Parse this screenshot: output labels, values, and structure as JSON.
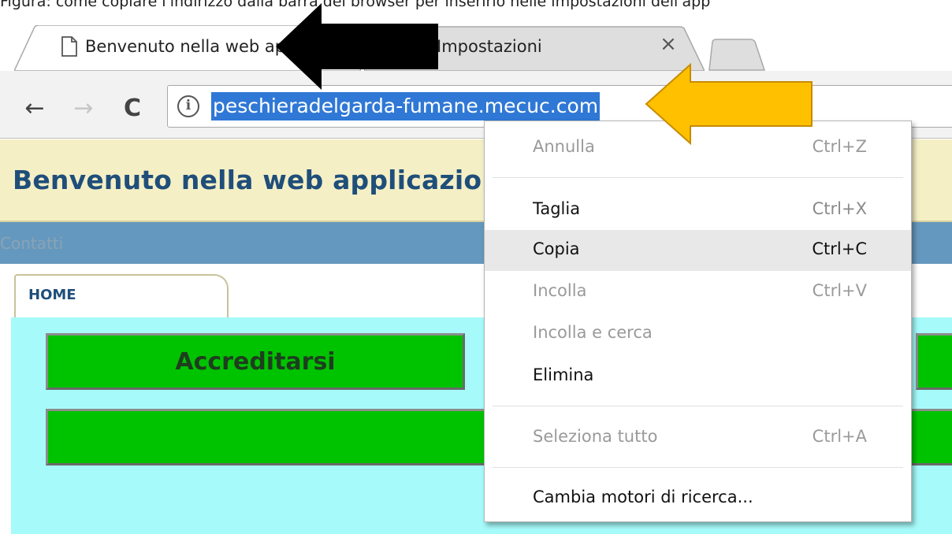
{
  "caption": "Figura: come copiare l'indirizzo dalla barra del browser per inserirlo nelle impostazioni dell'app",
  "tabs": [
    {
      "title": "Benvenuto nella web applicazione",
      "active": true
    },
    {
      "title": "Impostazioni",
      "active": false
    }
  ],
  "toolbar": {
    "url": "peschieradelgarda-fumane.mecuc.com",
    "icons": {
      "back": "arrow-left-icon",
      "forward": "arrow-right-icon",
      "reload": "reload-icon",
      "info": "info-icon"
    }
  },
  "page": {
    "banner_title": "Benvenuto nella web applicazione PRENOTAZIONE PASTI DI",
    "menubar": {
      "contatti": "Contatti"
    },
    "tab_home": "HOME",
    "buttons": {
      "accreditarsi": "Accreditarsi"
    }
  },
  "context_menu": {
    "items": [
      {
        "label": "Annulla",
        "shortcut": "Ctrl+Z",
        "enabled": false
      },
      {
        "label": "Taglia",
        "shortcut": "Ctrl+X",
        "enabled": true
      },
      {
        "label": "Copia",
        "shortcut": "Ctrl+C",
        "enabled": true,
        "hovered": true
      },
      {
        "label": "Incolla",
        "shortcut": "Ctrl+V",
        "enabled": false
      },
      {
        "label": "Incolla e cerca",
        "shortcut": "",
        "enabled": false
      },
      {
        "label": "Elimina",
        "shortcut": "",
        "enabled": true
      },
      {
        "label": "Seleziona tutto",
        "shortcut": "Ctrl+A",
        "enabled": false
      },
      {
        "label": "Cambia motori di ricerca...",
        "shortcut": "",
        "enabled": true
      }
    ]
  },
  "colors": {
    "url_highlight": "#2f78d6",
    "arrow_black": "#000000",
    "arrow_gold": "#ffc000",
    "button_green": "#00c300",
    "content_bg": "#a6fbfa",
    "menubar": "#6598be"
  }
}
